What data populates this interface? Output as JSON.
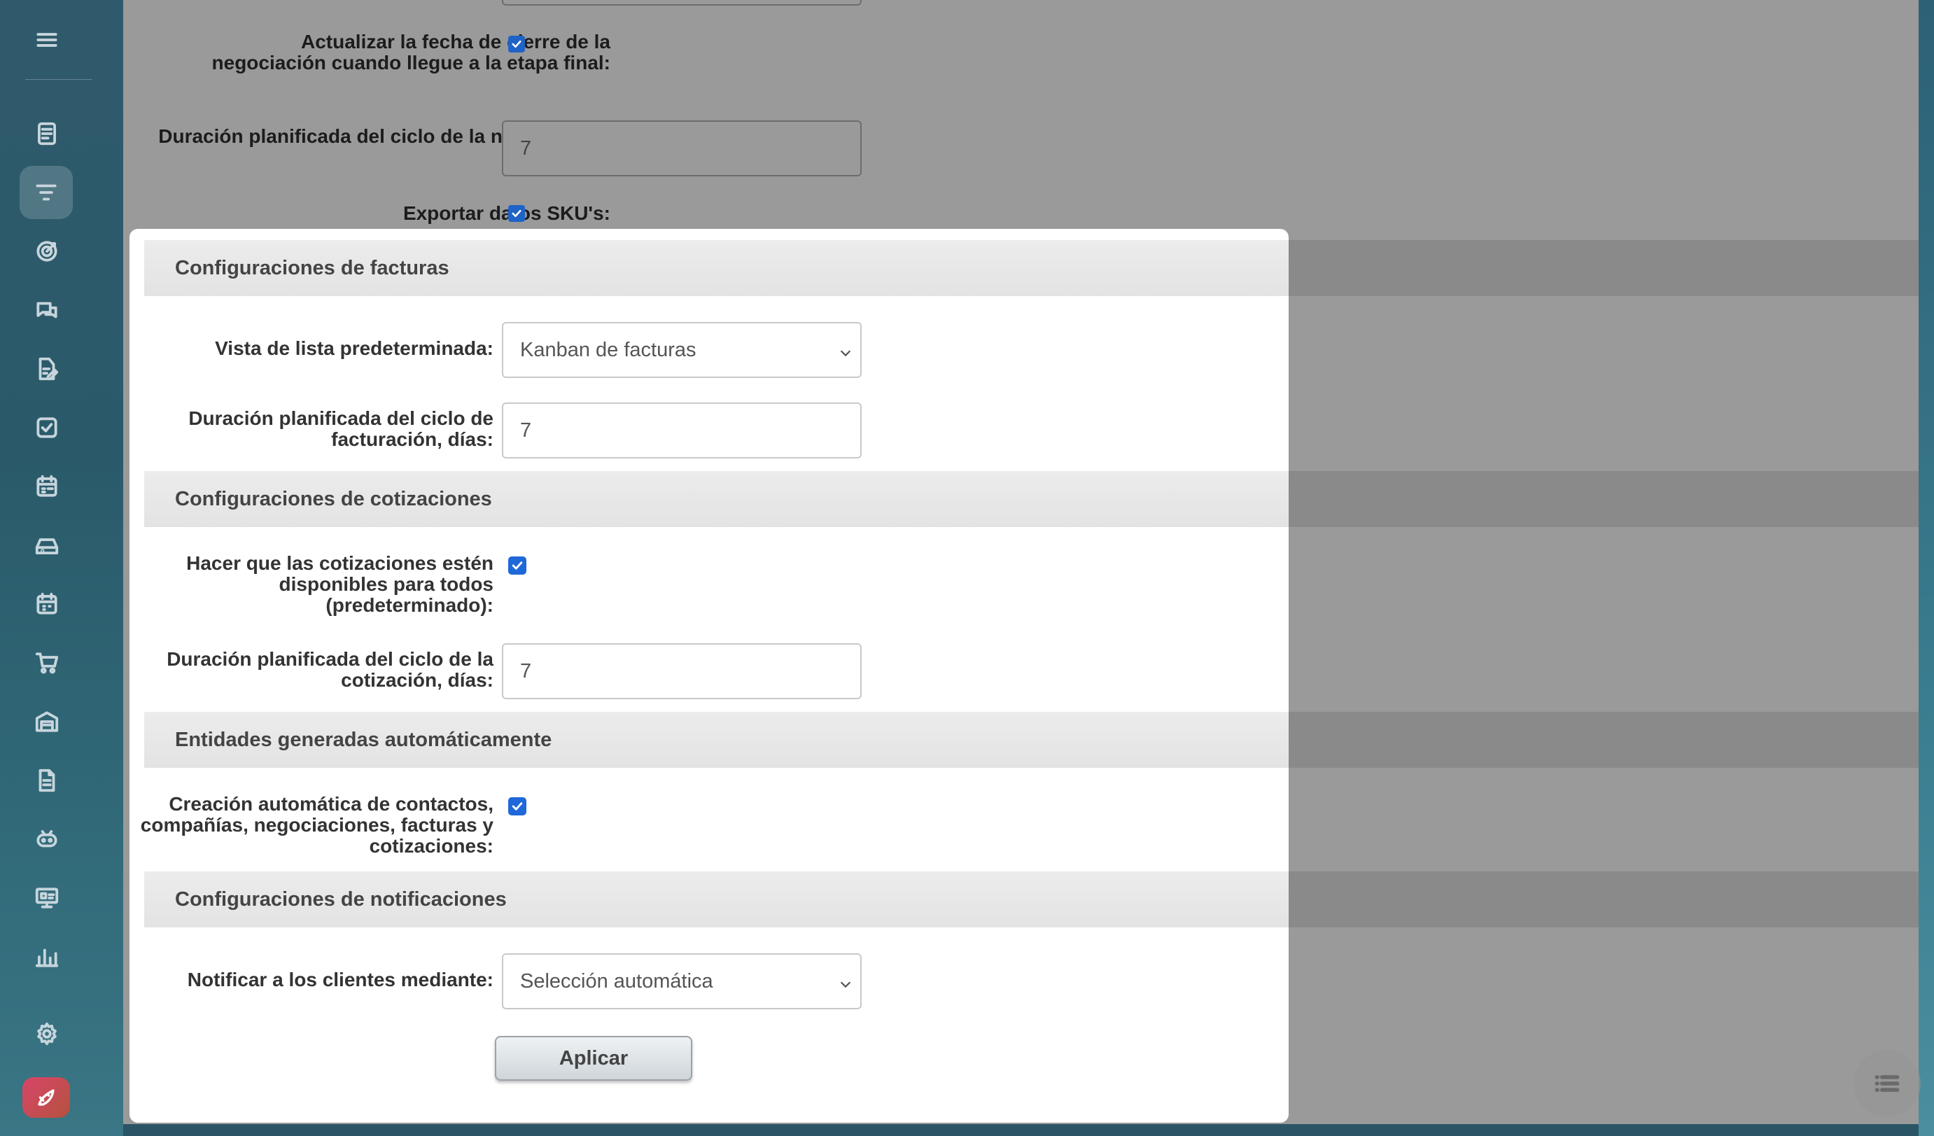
{
  "sidebar": {
    "icons": [
      "menu-icon",
      "document-icon",
      "funnel-icon",
      "target-icon",
      "chat-icon",
      "edit-document-icon",
      "task-icon",
      "calendar-grid-icon",
      "inbox-icon",
      "calendar-icon",
      "cart-icon",
      "warehouse-icon",
      "file-icon",
      "robot-icon",
      "presentation-icon",
      "analytics-icon",
      "settings-icon",
      "rocket-icon"
    ],
    "active": "funnel-icon"
  },
  "background": {
    "update_close_date_label": "Actualizar la fecha de cierre de la negociación cuando llegue a la etapa final:",
    "update_close_date_checked": true,
    "deal_cycle_label": "Duración planificada del ciclo de la negociación, días:",
    "deal_cycle_value": "7",
    "export_sku_label": "Exportar datos SKU's:",
    "export_sku_checked": true
  },
  "invoices": {
    "section_title": "Configuraciones de facturas",
    "default_view_label": "Vista de lista predeterminada:",
    "default_view_value": "Kanban de facturas",
    "billing_cycle_label": "Duración planificada del ciclo de facturación, días:",
    "billing_cycle_value": "7"
  },
  "quotes": {
    "section_title": "Configuraciones de cotizaciones",
    "available_all_label": "Hacer que las cotizaciones estén disponibles para todos (predeterminado):",
    "available_all_checked": true,
    "quote_cycle_label": "Duración planificada del ciclo de la cotización, días:",
    "quote_cycle_value": "7"
  },
  "auto_entities": {
    "section_title": "Entidades generadas automáticamente",
    "auto_create_label": "Creación automática de contactos, compañías, negociaciones, facturas y cotizaciones:",
    "auto_create_checked": true
  },
  "notifications": {
    "section_title": "Configuraciones de notificaciones",
    "notify_label": "Notificar a los clientes mediante:",
    "notify_value": "Selección automática"
  },
  "apply_label": "Aplicar",
  "colors": {
    "checkbox": "#1f68d8",
    "sidebar": "#2f5a6b",
    "overlay": "#9a9a9a"
  }
}
